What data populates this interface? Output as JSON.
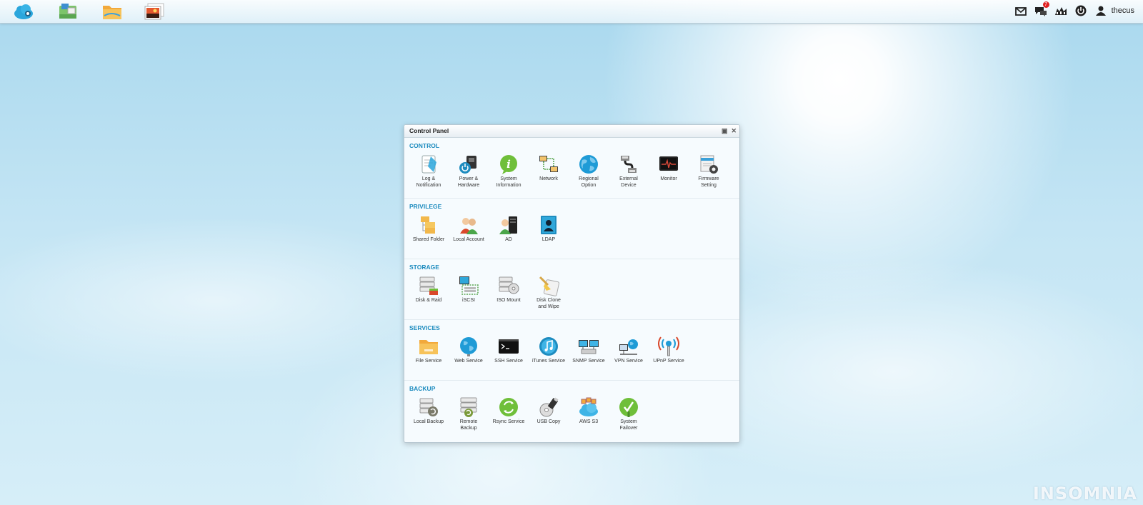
{
  "taskbar": {
    "apps": [
      {
        "name": "cloud-icon"
      },
      {
        "name": "app-center-icon"
      },
      {
        "name": "file-manager-icon"
      },
      {
        "name": "photo-viewer-icon"
      }
    ],
    "tray": {
      "notification_count": "7",
      "username": "thecus"
    }
  },
  "window": {
    "title": "Control Panel",
    "sections": [
      {
        "title": "CONTROL",
        "items": [
          "Log &\nNotification",
          "Power &\nHardware",
          "System\nInformation",
          "Network",
          "Regional\nOption",
          "External\nDevice",
          "Monitor",
          "Firmware\nSetting"
        ]
      },
      {
        "title": "PRIVILEGE",
        "items": [
          "Shared Folder",
          "Local Account",
          "AD",
          "LDAP"
        ]
      },
      {
        "title": "STORAGE",
        "items": [
          "Disk & Raid",
          "iSCSI",
          "ISO Mount",
          "Disk Clone\nand Wipe"
        ]
      },
      {
        "title": "SERVICES",
        "items": [
          "File Service",
          "Web Service",
          "SSH Service",
          "iTunes Service",
          "SNMP Service",
          "VPN Service",
          "UPnP Service"
        ]
      },
      {
        "title": "BACKUP",
        "items": [
          "Local Backup",
          "Remote\nBackup",
          "Rsync Service",
          "USB Copy",
          "AWS S3",
          "System\nFailover"
        ]
      }
    ]
  },
  "watermark": "INSOMNIA"
}
